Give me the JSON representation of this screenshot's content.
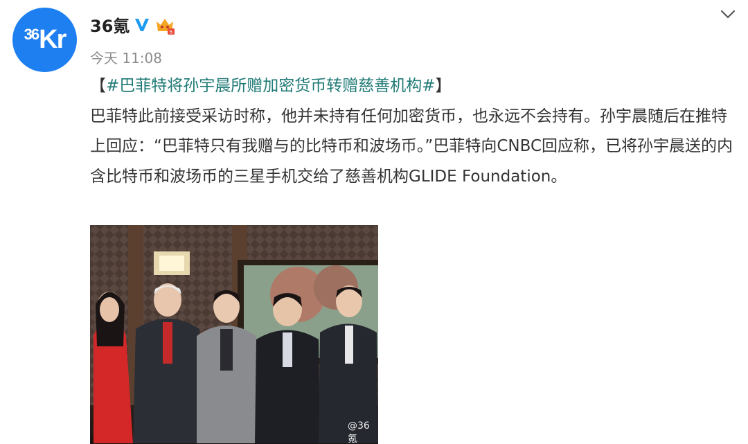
{
  "account": {
    "avatar_text": "36Kr",
    "username": "36氪",
    "timestamp": "今天 11:08"
  },
  "icons": {
    "verified": "verified-v-icon",
    "vip": "vip-crown-icon",
    "menu": "chevron-down-icon"
  },
  "post": {
    "topic_open": "【",
    "topic": "#巴菲特将孙宇晨所赠加密货币转赠慈善机构#",
    "topic_close": "】",
    "body": "巴菲特此前接受采访时称，他并未持有任何加密货币，也永远不会持有。孙宇晨随后在推特上回应：“巴菲特只有我赠与的比特币和波场币。”巴菲特向CNBC回应称，已将孙宇晨送的内含比特币和波场币的三星手机交给了慈善机构GLIDE Foundation。"
  },
  "photo": {
    "watermark": "@36氪"
  },
  "colors": {
    "avatar_bg": "#1e7ff0",
    "topic": "#1f7a76",
    "verified": "#1e9bf0",
    "vip": "#f0a220"
  }
}
